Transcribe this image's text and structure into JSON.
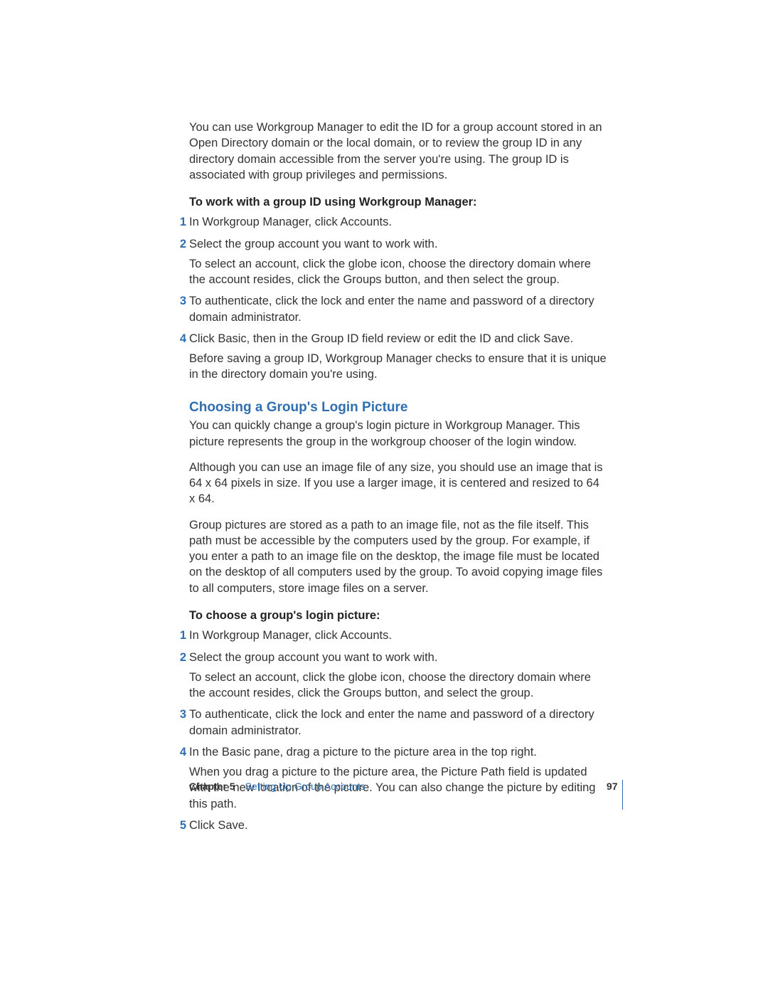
{
  "intro": "You can use Workgroup Manager to edit the ID for a group account stored in an Open Directory domain or the local domain, or to review the group ID in any directory domain accessible from the server you're using. The group ID is associated with group privileges and permissions.",
  "proc1": {
    "heading": "To work with a group ID using Workgroup Manager:",
    "steps": [
      {
        "n": "1",
        "paras": [
          "In Workgroup Manager, click Accounts."
        ]
      },
      {
        "n": "2",
        "paras": [
          "Select the group account you want to work with.",
          "To select an account, click the globe icon, choose the directory domain where the account resides, click the Groups button, and then select the group."
        ]
      },
      {
        "n": "3",
        "paras": [
          "To authenticate, click the lock and enter the name and password of a directory domain administrator."
        ]
      },
      {
        "n": "4",
        "paras": [
          "Click Basic, then in the Group ID field review or edit the ID and click Save.",
          "Before saving a group ID, Workgroup Manager checks to ensure that it is unique in the directory domain you're using."
        ]
      }
    ]
  },
  "section_heading": "Choosing a Group's Login Picture",
  "section_paras": [
    "You can quickly change a group's login picture in Workgroup Manager. This picture represents the group in the workgroup chooser of the login window.",
    "Although you can use an image file of any size, you should use an image that is 64 x 64 pixels in size. If you use a larger image, it is centered and resized to 64 x 64.",
    "Group pictures are stored as a path to an image file, not as the file itself. This path must be accessible by the computers used by the group. For example, if you enter a path to an image file on the desktop, the image file must be located on the desktop of all computers used by the group. To avoid copying image files to all computers, store image files on a server."
  ],
  "proc2": {
    "heading": "To choose a group's login picture:",
    "steps": [
      {
        "n": "1",
        "paras": [
          "In Workgroup Manager, click Accounts."
        ]
      },
      {
        "n": "2",
        "paras": [
          "Select the group account you want to work with.",
          "To select an account, click the globe icon, choose the directory domain where the account resides, click the Groups button, and select the group."
        ]
      },
      {
        "n": "3",
        "paras": [
          "To authenticate, click the lock and enter the name and password of a directory domain administrator."
        ]
      },
      {
        "n": "4",
        "paras": [
          "In the Basic pane, drag a picture to the picture area in the top right.",
          "When you drag a picture to the picture area, the Picture Path field is updated with the new location of the picture. You can also change the picture by editing this path."
        ]
      },
      {
        "n": "5",
        "paras": [
          "Click Save."
        ]
      }
    ]
  },
  "footer": {
    "chapter": "Chapter 5",
    "title": "Setting Up Group Accounts",
    "page": "97"
  }
}
